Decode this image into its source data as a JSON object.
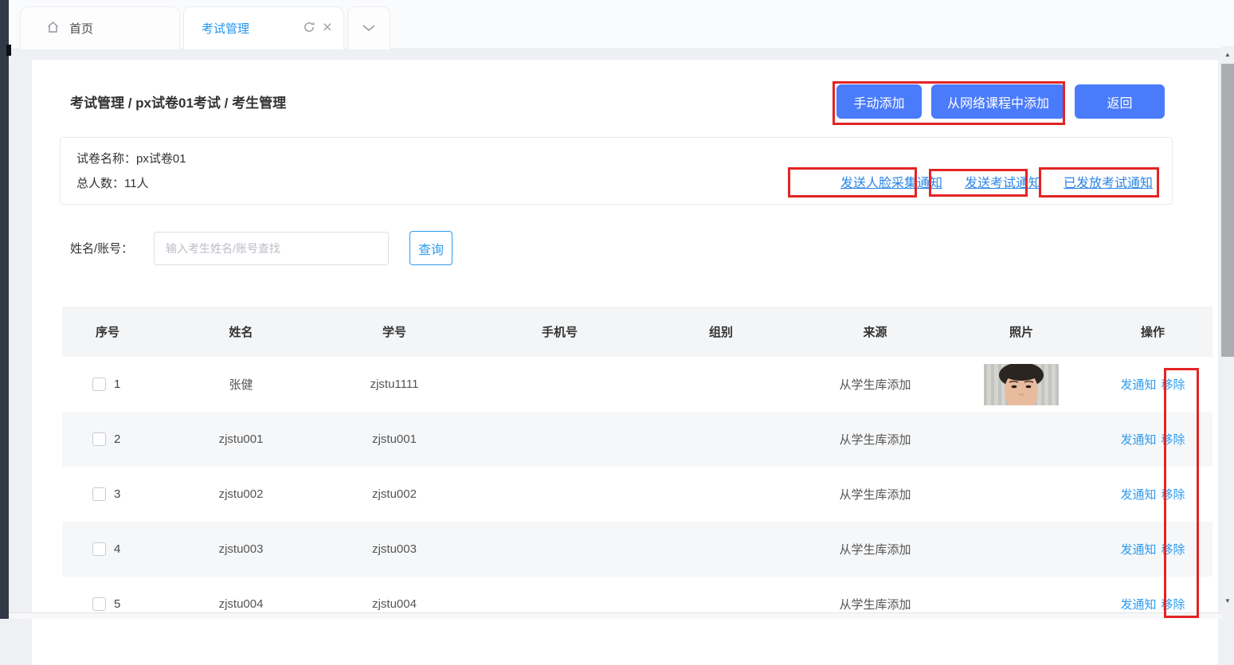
{
  "tabs": {
    "home_label": "首页",
    "active_label": "考试管理"
  },
  "page": {
    "breadcrumb": "考试管理 / px试卷01考试 / 考生管理"
  },
  "toolbar": {
    "manual_add": "手动添加",
    "add_from_course": "从网络课程中添加",
    "back": "返回"
  },
  "info": {
    "paper_label": "试卷名称：",
    "paper_name": "px试卷01",
    "total_label": "总人数：",
    "total_value": "11人",
    "links": {
      "face_notice": "发送人脸采集通知",
      "exam_notice": "发送考试通知",
      "sent_notice": "已发放考试通知"
    }
  },
  "search": {
    "label": "姓名/账号：",
    "placeholder": "输入考生姓名/账号查找",
    "button": "查询"
  },
  "table": {
    "headers": {
      "seq": "序号",
      "name": "姓名",
      "student_id": "学号",
      "phone": "手机号",
      "group": "组别",
      "source": "来源",
      "photo": "照片",
      "action": "操作"
    },
    "row_actions": {
      "notify": "发通知",
      "remove": "移除"
    },
    "rows": [
      {
        "seq": "1",
        "name": "张健",
        "student_id": "zjstu1111",
        "phone": "",
        "group": "",
        "source": "从学生库添加",
        "photo": "female-portrait"
      },
      {
        "seq": "2",
        "name": "zjstu001",
        "student_id": "zjstu001",
        "phone": "",
        "group": "",
        "source": "从学生库添加",
        "photo": ""
      },
      {
        "seq": "3",
        "name": "zjstu002",
        "student_id": "zjstu002",
        "phone": "",
        "group": "",
        "source": "从学生库添加",
        "photo": ""
      },
      {
        "seq": "4",
        "name": "zjstu003",
        "student_id": "zjstu003",
        "phone": "",
        "group": "",
        "source": "从学生库添加",
        "photo": ""
      },
      {
        "seq": "5",
        "name": "zjstu004",
        "student_id": "zjstu004",
        "phone": "",
        "group": "",
        "source": "从学生库添加",
        "photo": ""
      }
    ]
  },
  "colors": {
    "primary_button_blue": "#4a7bfa",
    "tab_active_blue": "#2396f0",
    "info_link_blue": "#2b85e6",
    "table_link_blue": "#2d9cf0",
    "annotation_red": "#e32424",
    "sidebar_dark": "#323845"
  }
}
